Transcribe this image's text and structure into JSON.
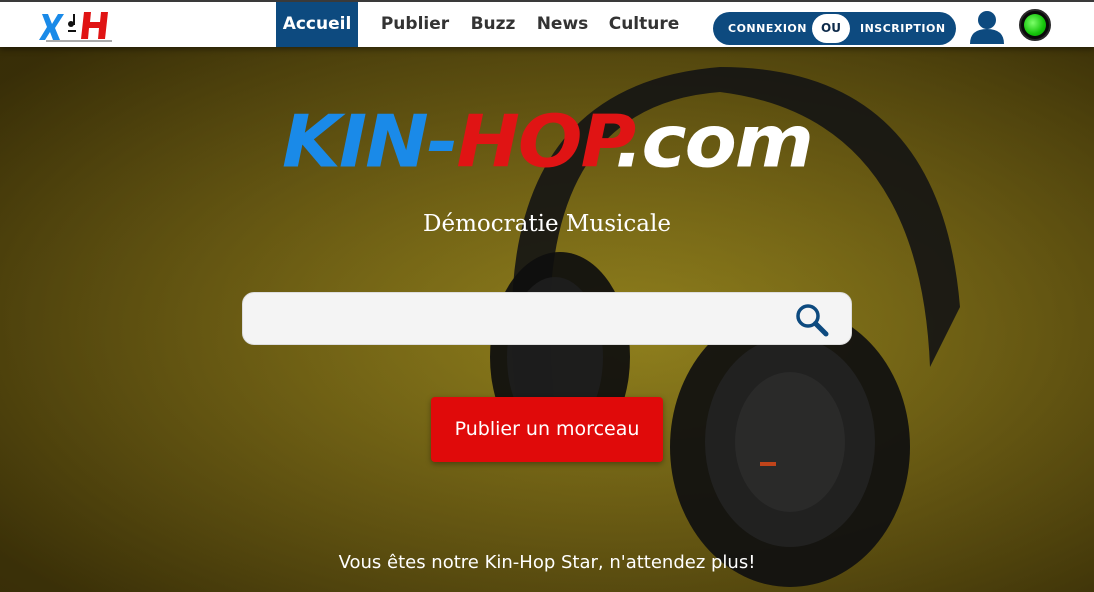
{
  "nav": {
    "logo_alt_icon": "kinhop-logo-icon",
    "links": [
      "Accueil",
      "Publier",
      "Buzz",
      "News",
      "Culture"
    ],
    "active": "Accueil",
    "auth": {
      "login": "CONNEXION",
      "or": "OU",
      "signup": "INSCRIPTION"
    },
    "user_icon": "user-icon",
    "status_icon": "online-status-icon"
  },
  "hero": {
    "brand_kin": "KIN-",
    "brand_hop": "HOP",
    "brand_com": ".com",
    "tagline": "Démocratie Musicale",
    "search": {
      "value": "",
      "placeholder": "",
      "icon": "search-icon"
    },
    "publish_label": "Publier un morceau",
    "footer_note": "Vous êtes notre Kin-Hop Star, n'attendez plus!"
  },
  "colors": {
    "nav_active": "#0d4a7f",
    "brand_blue": "#1a8ae8",
    "brand_red": "#e01414",
    "publish_red": "#e00a0a",
    "status_green": "#14c40a"
  }
}
